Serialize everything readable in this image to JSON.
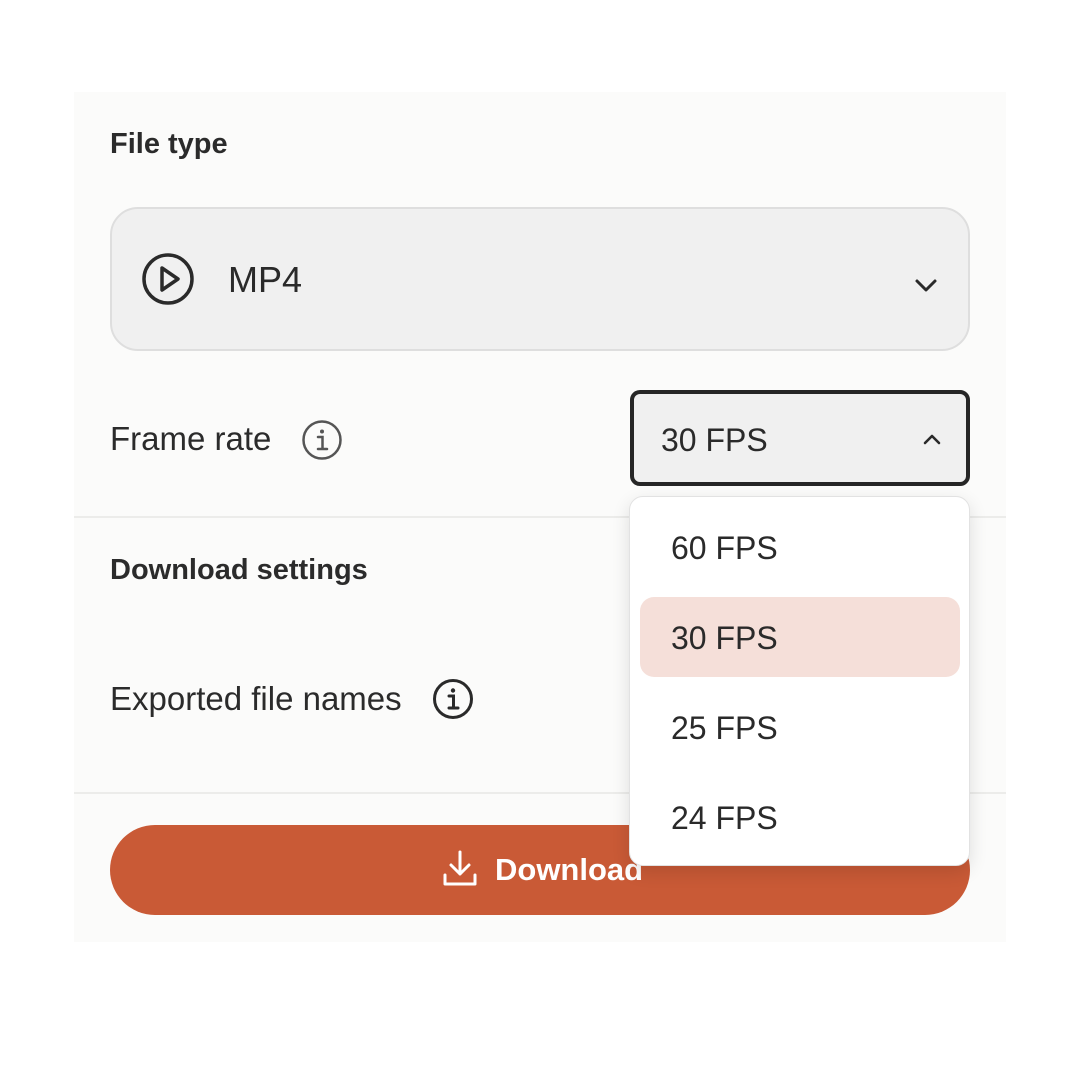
{
  "file_type": {
    "title": "File type",
    "selected": "MP4",
    "icon": "play-circle-icon"
  },
  "frame_rate": {
    "label": "Frame rate",
    "selected": "30 FPS",
    "options": [
      "60 FPS",
      "30 FPS",
      "25 FPS",
      "24 FPS"
    ],
    "highlighted_option": "30 FPS"
  },
  "download_settings": {
    "title": "Download settings",
    "exported_file_names_label": "Exported file names"
  },
  "download_button": {
    "label": "Download"
  },
  "colors": {
    "accent": "#c95a36",
    "highlight": "#f5dfd9",
    "panel_bg": "#fbfbfa"
  }
}
